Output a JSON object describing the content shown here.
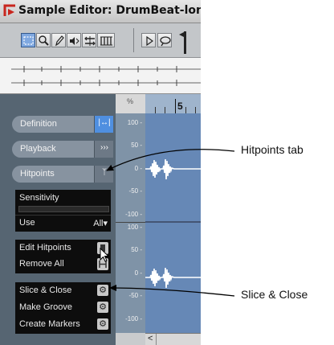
{
  "window": {
    "title": "Sample Editor: DrumBeat-long",
    "logo_icon": "cubase-logo-icon"
  },
  "toolbar": {
    "tools": [
      {
        "name": "range-select-tool",
        "icon": "marquee-icon"
      },
      {
        "name": "zoom-tool",
        "icon": "magnifier-icon"
      },
      {
        "name": "draw-tool",
        "icon": "pencil-icon"
      },
      {
        "name": "play-tool",
        "icon": "speaker-icon"
      },
      {
        "name": "scrub-tool",
        "icon": "scrub-icon"
      },
      {
        "name": "grid-tool",
        "icon": "grid-icon"
      },
      {
        "name": "play-button",
        "icon": "play-triangle-icon"
      },
      {
        "name": "loop-button",
        "icon": "loop-icon"
      }
    ]
  },
  "inspector": {
    "tabs": [
      {
        "label": "Definition",
        "button": "|↔|"
      },
      {
        "label": "Playback",
        "button": "›››"
      },
      {
        "label": "Hitpoints",
        "button": "ᛉ"
      }
    ],
    "sensitivity": {
      "label": "Sensitivity"
    },
    "use": {
      "label": "Use",
      "value": "All"
    },
    "actions1": [
      {
        "label": "Edit Hitpoints"
      },
      {
        "label": "Remove All"
      }
    ],
    "actions2": [
      {
        "label": "Slice & Close"
      },
      {
        "label": "Make Groove"
      },
      {
        "label": "Create Markers"
      }
    ]
  },
  "editor": {
    "ruler_unit": "%",
    "ruler_marker": "5",
    "scale_ticks": [
      "100 -",
      "50 -",
      "0 -",
      "-50 -",
      "-100 -",
      "100 -",
      "50 -",
      "0 -",
      "-50 -",
      "-100 -"
    ],
    "scroll_left": "<"
  },
  "callouts": {
    "hitpoints_tab": "Hitpoints tab",
    "slice_close": "Slice & Close"
  },
  "colors": {
    "accent_blue": "#4f8fe0",
    "inspector_bg": "#566572",
    "waveform_bg": "#6688b6"
  }
}
